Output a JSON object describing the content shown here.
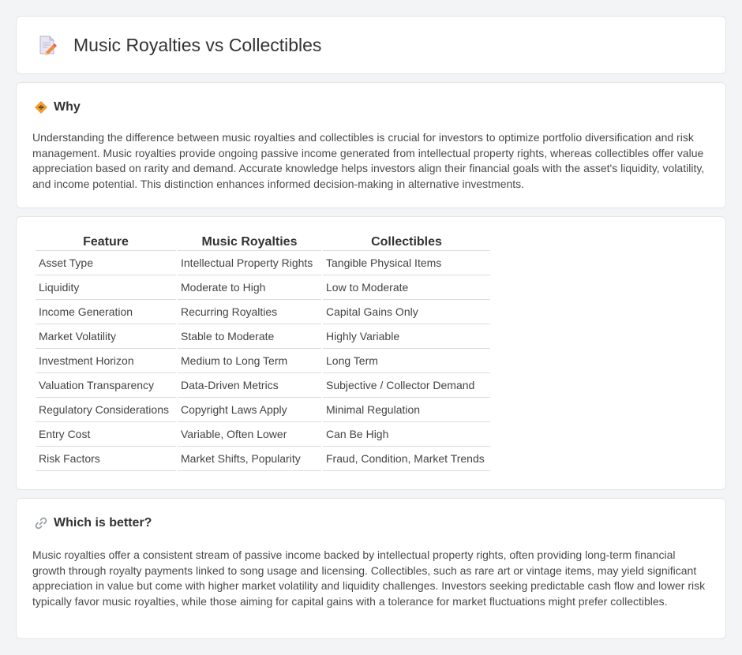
{
  "header": {
    "title": "Music Royalties vs Collectibles",
    "icon": "document-pencil-icon"
  },
  "why": {
    "title": "Why",
    "icon": "diamond-icon",
    "text": "Understanding the difference between music royalties and collectibles is crucial for investors to optimize portfolio diversification and risk management. Music royalties provide ongoing passive income generated from intellectual property rights, whereas collectibles offer value appreciation based on rarity and demand. Accurate knowledge helps investors align their financial goals with the asset's liquidity, volatility, and income potential. This distinction enhances informed decision-making in alternative investments."
  },
  "comparison": {
    "headers": [
      "Feature",
      "Music Royalties",
      "Collectibles"
    ],
    "rows": [
      [
        "Asset Type",
        "Intellectual Property Rights",
        "Tangible Physical Items"
      ],
      [
        "Liquidity",
        "Moderate to High",
        "Low to Moderate"
      ],
      [
        "Income Generation",
        "Recurring Royalties",
        "Capital Gains Only"
      ],
      [
        "Market Volatility",
        "Stable to Moderate",
        "Highly Variable"
      ],
      [
        "Investment Horizon",
        "Medium to Long Term",
        "Long Term"
      ],
      [
        "Valuation Transparency",
        "Data-Driven Metrics",
        "Subjective / Collector Demand"
      ],
      [
        "Regulatory Considerations",
        "Copyright Laws Apply",
        "Minimal Regulation"
      ],
      [
        "Entry Cost",
        "Variable, Often Lower",
        "Can Be High"
      ],
      [
        "Risk Factors",
        "Market Shifts, Popularity",
        "Fraud, Condition, Market Trends"
      ]
    ]
  },
  "better": {
    "title": "Which is better?",
    "icon": "link-icon",
    "text": "Music royalties offer a consistent stream of passive income backed by intellectual property rights, often providing long-term financial growth through royalty payments linked to song usage and licensing. Collectibles, such as rare art or vintage items, may yield significant appreciation in value but come with higher market volatility and liquidity challenges. Investors seeking predictable cash flow and lower risk typically favor music royalties, while those aiming for capital gains with a tolerance for market fluctuations might prefer collectibles."
  },
  "colors": {
    "background": "#f3f4f6",
    "card": "#ffffff",
    "border": "#e2e4e8",
    "accent_orange": "#f0a030"
  }
}
